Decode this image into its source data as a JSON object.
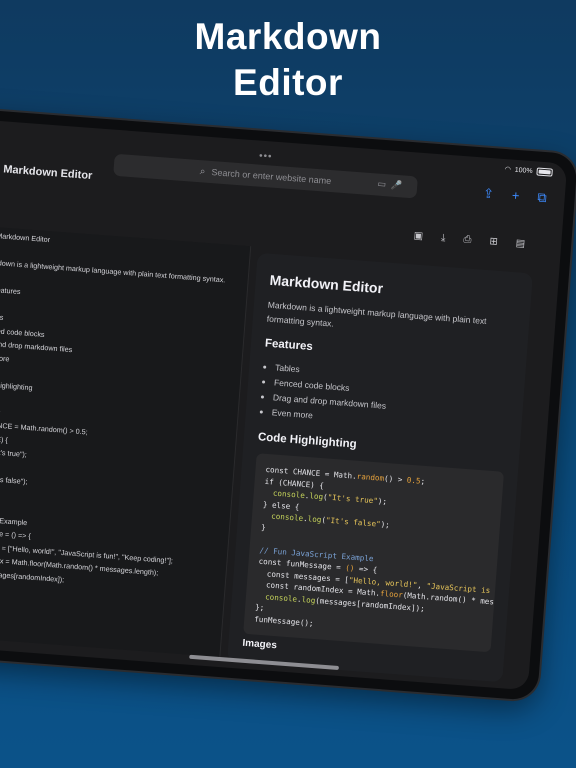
{
  "headline": {
    "line1": "Markdown",
    "line2": "Editor"
  },
  "status_bar": {
    "battery": "100%"
  },
  "browser": {
    "url_placeholder": "Search or enter website name",
    "icons": [
      "share-icon",
      "plus-icon",
      "tabs-icon"
    ]
  },
  "app": {
    "title": "Markdown Editor",
    "toolbar_icons": [
      "save-icon",
      "download-icon",
      "print-icon",
      "export-icon",
      "file-icon"
    ]
  },
  "editor_lines": [
    "Markdown Editor",
    "",
    "kdown is a lightweight markup language with plain text formatting syntax.",
    "",
    "Features",
    "",
    "bles",
    "nced code blocks",
    "g and drop markdown files",
    "n more",
    "",
    "de Highlighting",
    "",
    "script",
    "CHANCE = Math.random() > 0.5;",
    "ANCE) {",
    ".log(\"It's true\");",
    "",
    ".log(\"It's false\");",
    "",
    "",
    "aScript Example",
    "Message = () => {",
    "essages = [\"Hello, world!\", \"JavaScript is fun!\", \"Keep coding!\"];",
    "domIndex = Math.floor(Math.random() * messages.length);",
    "og(messages[randomIndex]);",
    "",
    "();"
  ],
  "preview": {
    "title": "Markdown Editor",
    "intro": "Markdown is a lightweight markup language with plain text formatting syntax.",
    "features_heading": "Features",
    "features": [
      "Tables",
      "Fenced code blocks",
      "Drag and drop markdown files",
      "Even more"
    ],
    "code_heading": "Code Highlighting",
    "images_heading": "Images"
  }
}
